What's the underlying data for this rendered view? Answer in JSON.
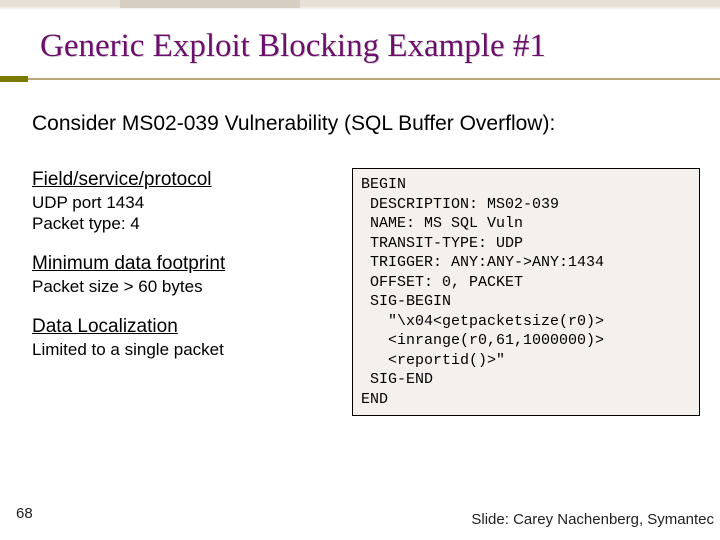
{
  "title": "Generic Exploit Blocking Example #1",
  "intro": "Consider MS02-039 Vulnerability (SQL Buffer Overflow):",
  "sections": {
    "field": {
      "head": "Field/service/protocol",
      "line1": "UDP port 1434",
      "line2": "Packet type: 4"
    },
    "footprint": {
      "head": "Minimum data footprint",
      "line1": "Packet size > 60 bytes"
    },
    "localization": {
      "head": "Data Localization",
      "line1": "Limited to a single packet"
    }
  },
  "code": "BEGIN\n DESCRIPTION: MS02-039\n NAME: MS SQL Vuln\n TRANSIT-TYPE: UDP\n TRIGGER: ANY:ANY->ANY:1434\n OFFSET: 0, PACKET\n SIG-BEGIN\n   \"\\x04<getpacketsize(r0)>\n   <inrange(r0,61,1000000)>\n   <reportid()>\"\n SIG-END\nEND",
  "page_num": "68",
  "credit": "Slide: Carey Nachenberg, Symantec"
}
